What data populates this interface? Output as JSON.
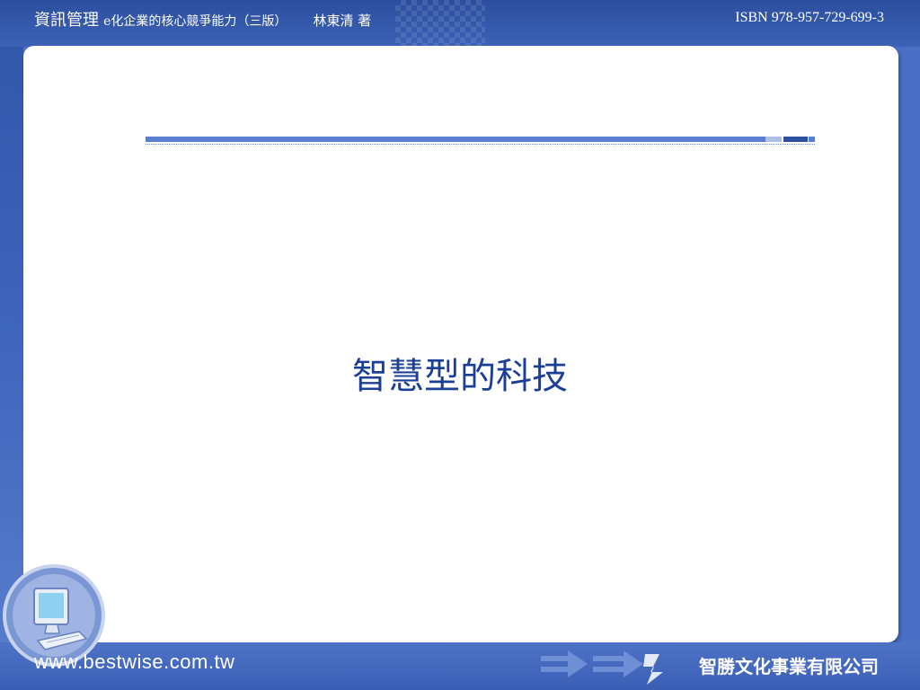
{
  "header": {
    "book_title": "資訊管理",
    "book_subtitle": "e化企業的核心競爭能力（三版）",
    "author": "林東清 著",
    "isbn": "ISBN 978-957-729-699-3"
  },
  "slide": {
    "title": "智慧型的科技"
  },
  "footer": {
    "url": "www.bestwise.com.tw",
    "publisher": "智勝文化事業有限公司",
    "icons": [
      "computer-icon",
      "arrow-icon"
    ]
  },
  "colors": {
    "background": "#4a6fc4",
    "title": "#1b3f94",
    "panel": "#ffffff",
    "accent_dark": "#2c4e9e"
  }
}
